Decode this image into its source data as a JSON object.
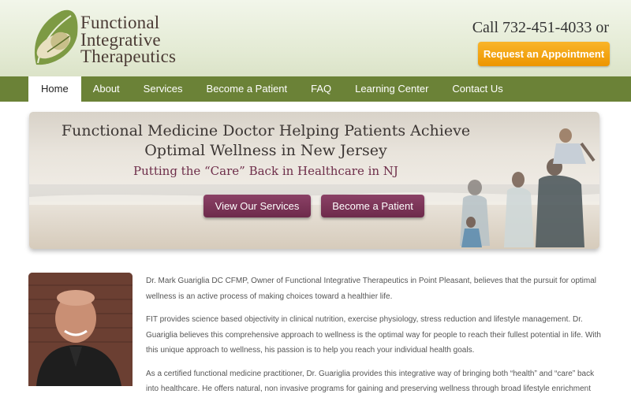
{
  "header": {
    "logo_lines": [
      "Functional",
      "Integrative",
      "Therapeutics"
    ],
    "phone": "Call 732-451-4033 or",
    "appointment_button": "Request an Appointment"
  },
  "nav": {
    "items": [
      {
        "label": "Home",
        "active": true
      },
      {
        "label": "About",
        "active": false
      },
      {
        "label": "Services",
        "active": false
      },
      {
        "label": "Become a Patient",
        "active": false
      },
      {
        "label": "FAQ",
        "active": false
      },
      {
        "label": "Learning Center",
        "active": false
      },
      {
        "label": "Contact Us",
        "active": false
      }
    ]
  },
  "hero": {
    "title_line1": "Functional Medicine Doctor Helping Patients Achieve",
    "title_line2": "Optimal Wellness in New Jersey",
    "subtitle": "Putting the “Care” Back in Healthcare in NJ",
    "button_services": "View Our Services",
    "button_patient": "Become a Patient"
  },
  "content": {
    "paragraphs": [
      "Dr. Mark Guariglia DC CFMP, Owner of Functional Integrative Therapeutics in Point Pleasant, believes that the pursuit for optimal wellness is an active process of making choices toward a healthier life.",
      "FIT provides science based objectivity in clinical nutrition, exercise physiology, stress reduction and lifestyle management. Dr. Guariglia believes this comprehensive approach to wellness is the optimal way for people to reach their fullest potential in life. With this unique approach to wellness, his passion is to help you reach your individual health goals.",
      "As a certified functional medicine practitioner, Dr. Guariglia provides this integrative way of bringing both “health” and “care” back into healthcare. He offers natural, non invasive programs for gaining and preserving wellness through broad lifestyle enrichment"
    ]
  },
  "colors": {
    "nav_green": "#6b8237",
    "accent_orange": "#f0a010",
    "hero_button_plum": "#7a345a",
    "logo_brown": "#4a3a34"
  }
}
